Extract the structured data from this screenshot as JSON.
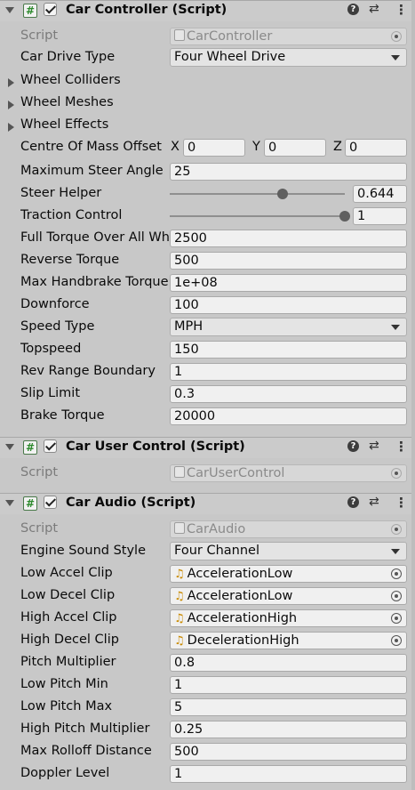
{
  "car_controller": {
    "title": "Car Controller (Script)",
    "script_label": "Script",
    "script_value": "CarController",
    "drive_type_label": "Car Drive Type",
    "drive_type_value": "Four Wheel Drive",
    "wheel_colliders_label": "Wheel Colliders",
    "wheel_meshes_label": "Wheel Meshes",
    "wheel_effects_label": "Wheel Effects",
    "com_offset_label": "Centre Of Mass Offset",
    "com_x_label": "X",
    "com_x": "0",
    "com_y_label": "Y",
    "com_y": "0",
    "com_z_label": "Z",
    "com_z": "0",
    "max_steer_label": "Maximum Steer Angle",
    "max_steer": "25",
    "steer_helper_label": "Steer Helper",
    "steer_helper": "0.644",
    "traction_label": "Traction Control",
    "traction": "1",
    "full_torque_label": "Full Torque Over All Wheels",
    "full_torque": "2500",
    "reverse_torque_label": "Reverse Torque",
    "reverse_torque": "500",
    "handbrake_label": "Max Handbrake Torque",
    "handbrake": "1e+08",
    "downforce_label": "Downforce",
    "downforce": "100",
    "speed_type_label": "Speed Type",
    "speed_type": "MPH",
    "topspeed_label": "Topspeed",
    "topspeed": "150",
    "rev_range_label": "Rev Range Boundary",
    "rev_range": "1",
    "slip_limit_label": "Slip Limit",
    "slip_limit": "0.3",
    "brake_torque_label": "Brake Torque",
    "brake_torque": "20000"
  },
  "car_user_control": {
    "title": "Car User Control (Script)",
    "script_label": "Script",
    "script_value": "CarUserControl"
  },
  "car_audio": {
    "title": "Car Audio (Script)",
    "script_label": "Script",
    "script_value": "CarAudio",
    "engine_style_label": "Engine Sound Style",
    "engine_style": "Four Channel",
    "low_accel_label": "Low Accel Clip",
    "low_accel": "AccelerationLow",
    "low_decel_label": "Low Decel Clip",
    "low_decel": "AccelerationLow",
    "high_accel_label": "High Accel Clip",
    "high_accel": "AccelerationHigh",
    "high_decel_label": "High Decel Clip",
    "high_decel": "DecelerationHigh",
    "pitch_mult_label": "Pitch Multiplier",
    "pitch_mult": "0.8",
    "low_pitch_min_label": "Low Pitch Min",
    "low_pitch_min": "1",
    "low_pitch_max_label": "Low Pitch Max",
    "low_pitch_max": "5",
    "high_pitch_mult_label": "High Pitch Multiplier",
    "high_pitch_mult": "0.25",
    "max_rolloff_label": "Max Rolloff Distance",
    "max_rolloff": "500",
    "doppler_label": "Doppler Level",
    "doppler": "1"
  },
  "icons": {
    "script": "script-hash-icon",
    "help": "help-icon",
    "presets": "presets-sliders-icon",
    "menu": "kebab-menu-icon",
    "audio_clip": "audio-clip-note-icon",
    "object_picker": "object-picker-target-icon"
  },
  "sliders": {
    "steer_helper_level": 0.644,
    "traction_level": 1
  },
  "colors": {
    "background": "#c8c8c8",
    "field_bg": "#f0f0f0",
    "header_bg": "#cbcbcb",
    "script_icon": "#2c8a2c",
    "audio_note": "#c98a00"
  }
}
